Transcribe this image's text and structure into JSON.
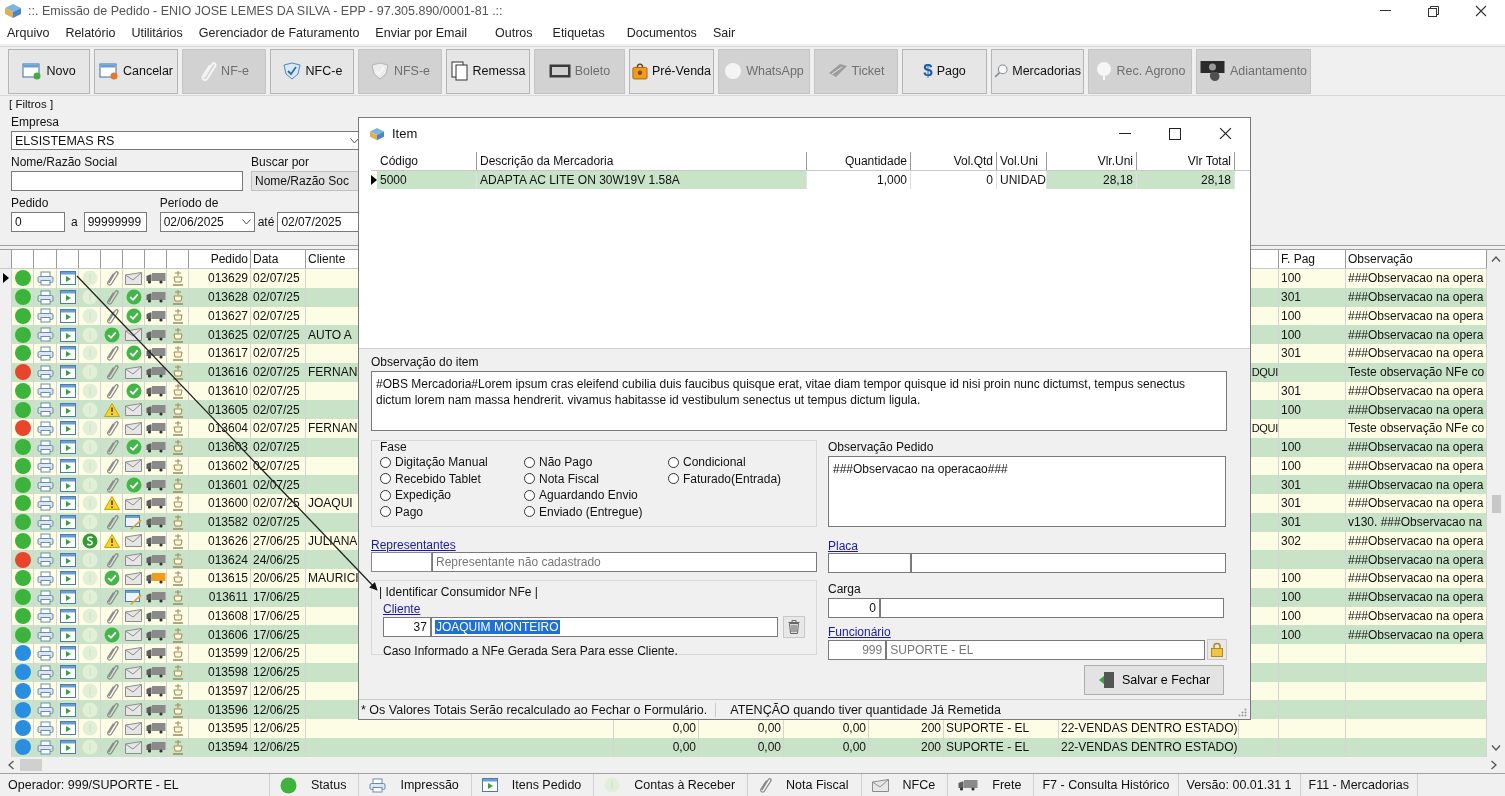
{
  "window": {
    "title": "::. Emissão de Pedido - ENIO JOSE LEMES DA SILVA - EPP - 97.305.890/0001-81 .::"
  },
  "menu": [
    "Arquivo",
    "Relatório",
    "Utilitários",
    "Gerenciador de Faturamento",
    "Enviar por Email",
    "Outros",
    "Etiquetas",
    "Documentos",
    "Sair"
  ],
  "toolbar": [
    {
      "label": "Novo",
      "disabled": false
    },
    {
      "label": "Cancelar",
      "disabled": false
    },
    {
      "label": "NF-e",
      "disabled": true
    },
    {
      "label": "NFC-e",
      "disabled": false
    },
    {
      "label": "NFS-e",
      "disabled": true
    },
    {
      "label": "Remessa",
      "disabled": false
    },
    {
      "label": "Boleto",
      "disabled": true
    },
    {
      "label": "Pré-Venda",
      "disabled": false
    },
    {
      "label": "WhatsApp",
      "disabled": true
    },
    {
      "label": "Ticket",
      "disabled": true
    },
    {
      "label": "Pago",
      "disabled": false,
      "symbol": "$"
    },
    {
      "label": "Mercadorias",
      "disabled": false
    },
    {
      "label": "Rec. Agrono",
      "disabled": true
    },
    {
      "label": "Adiantamento",
      "disabled": true
    }
  ],
  "filters": {
    "title": "[ Filtros ]",
    "empresa": {
      "label": "Empresa",
      "value": "ELSISTEMAS RS"
    },
    "nome": {
      "label": "Nome/Razão Social"
    },
    "buscar_por": {
      "label": "Buscar por",
      "value": "Nome/Razão Soc"
    },
    "pedido": {
      "label": "Pedido",
      "from": "0",
      "separator": "a",
      "to": "99999999"
    },
    "periodo": {
      "label": "Período de",
      "from": "02/06/2025",
      "separator": "até",
      "to": "02/07/2025"
    }
  },
  "grid": {
    "columns": [
      "Pedido",
      "Data",
      "Cliente",
      "F. Pag",
      "Observação"
    ],
    "rows": [
      {
        "selected": true,
        "color": "#3cb43c",
        "pago": false,
        "nota": {
          "kind": "clip"
        },
        "nfce": {
          "kind": "mail"
        },
        "frete": false,
        "pedido": "013629",
        "data": "02/07/25",
        "f_pag": "100",
        "observacao": "###Observacao na opera"
      },
      {
        "selected": false,
        "color": "#3cb43c",
        "pago": false,
        "nota": {
          "kind": "clip"
        },
        "nfce": {
          "kind": "check"
        },
        "frete": false,
        "pedido": "013628",
        "data": "02/07/25",
        "f_pag": "301",
        "observacao": "###Observacao na opera"
      },
      {
        "selected": false,
        "color": "#3cb43c",
        "pago": false,
        "nota": {
          "kind": "clip"
        },
        "nfce": {
          "kind": "check"
        },
        "frete": false,
        "pedido": "013627",
        "data": "02/07/25",
        "f_pag": "100",
        "observacao": "###Observacao na opera"
      },
      {
        "selected": false,
        "color": "#3cb43c",
        "pago": false,
        "nota": {
          "kind": "check"
        },
        "nfce": {
          "kind": "mail"
        },
        "frete": false,
        "pedido": "013625",
        "data": "02/07/25",
        "cliente": "AUTO A",
        "f_pag": "100",
        "observacao": "###Observacao na opera"
      },
      {
        "selected": false,
        "color": "#3cb43c",
        "pago": false,
        "nota": {
          "kind": "clip"
        },
        "nfce": {
          "kind": "check"
        },
        "frete": false,
        "pedido": "013617",
        "data": "02/07/25",
        "f_pag": "301",
        "observacao": "###Observacao na opera"
      },
      {
        "selected": false,
        "color": "#e8452c",
        "pago": false,
        "nota": {
          "kind": "clip"
        },
        "nfce": {
          "kind": "mail"
        },
        "frete": false,
        "pedido": "013616",
        "data": "02/07/25",
        "cliente": "FERNAN",
        "column_15": "DQUI",
        "observacao": "Teste observação NFe co"
      },
      {
        "selected": false,
        "color": "#3cb43c",
        "pago": false,
        "nota": {
          "kind": "clip"
        },
        "nfce": {
          "kind": "check"
        },
        "frete": false,
        "pedido": "013610",
        "data": "02/07/25",
        "f_pag": "301",
        "observacao": "###Observacao na opera"
      },
      {
        "selected": false,
        "color": "#3cb43c",
        "pago": false,
        "nota": {
          "kind": "warning"
        },
        "nfce": {
          "kind": "mail"
        },
        "frete": false,
        "pedido": "013605",
        "data": "02/07/25",
        "f_pag": "100",
        "observacao": "###Observacao na opera"
      },
      {
        "selected": false,
        "color": "#e8452c",
        "pago": false,
        "nota": {
          "kind": "clip"
        },
        "nfce": {
          "kind": "mail"
        },
        "frete": false,
        "pedido": "013604",
        "data": "02/07/25",
        "cliente": "FERNAN",
        "column_15": "DQUI",
        "observacao": "Teste observação NFe co"
      },
      {
        "selected": false,
        "color": "#3cb43c",
        "pago": false,
        "nota": {
          "kind": "clip"
        },
        "nfce": {
          "kind": "check"
        },
        "frete": false,
        "pedido": "013603",
        "data": "02/07/25",
        "f_pag": "100",
        "observacao": "###Observacao na opera"
      },
      {
        "selected": false,
        "color": "#3cb43c",
        "pago": false,
        "nota": {
          "kind": "clip"
        },
        "nfce": {
          "kind": "mail"
        },
        "frete": false,
        "pedido": "013602",
        "data": "02/07/25",
        "f_pag": "100",
        "observacao": "###Observacao na opera"
      },
      {
        "selected": false,
        "color": "#3cb43c",
        "pago": false,
        "nota": {
          "kind": "clip"
        },
        "nfce": {
          "kind": "check"
        },
        "frete": false,
        "pedido": "013601",
        "data": "02/07/25",
        "f_pag": "301",
        "observacao": "###Observacao na opera"
      },
      {
        "selected": false,
        "color": "#3cb43c",
        "pago": false,
        "nota": {
          "kind": "warning"
        },
        "nfce": {
          "kind": "mail"
        },
        "frete": false,
        "pedido": "013600",
        "data": "02/07/25",
        "cliente": "JOAQUI",
        "f_pag": "301",
        "observacao": "###Observacao na opera"
      },
      {
        "selected": false,
        "color": "#3cb43c",
        "pago": false,
        "nota": {
          "kind": "clip"
        },
        "nfce": {
          "kind": "edit"
        },
        "frete": false,
        "pedido": "013582",
        "data": "02/07/25",
        "f_pag": "301",
        "observacao": "v130. ###Observacao na"
      },
      {
        "selected": false,
        "color": "#3cb43c",
        "pago": true,
        "nota": {
          "kind": "warning"
        },
        "nfce": {
          "kind": "mail"
        },
        "frete": false,
        "pedido": "013626",
        "data": "27/06/25",
        "cliente": "JULIANA",
        "f_pag": "302",
        "observacao": "###Observacao na opera"
      },
      {
        "selected": false,
        "color": "#e8452c",
        "pago": false,
        "nota": {
          "kind": "clip"
        },
        "nfce": {
          "kind": "mail"
        },
        "frete": false,
        "pedido": "013624",
        "data": "24/06/25",
        "observacao": "###Observacao na opera"
      },
      {
        "selected": false,
        "color": "#3cb43c",
        "pago": false,
        "nota": {
          "kind": "check"
        },
        "nfce": {
          "kind": "mail"
        },
        "frete": true,
        "pedido": "013615",
        "data": "20/06/25",
        "cliente": "MAURICI",
        "f_pag": "100",
        "observacao": "###Observacao na opera"
      },
      {
        "selected": false,
        "color": "#3cb43c",
        "pago": false,
        "nota": {
          "kind": "clip"
        },
        "nfce": {
          "kind": "edit"
        },
        "frete": false,
        "pedido": "013611",
        "data": "17/06/25",
        "f_pag": "100",
        "observacao": "###Observacao na opera"
      },
      {
        "selected": false,
        "color": "#3cb43c",
        "pago": false,
        "nota": {
          "kind": "clip"
        },
        "nfce": {
          "kind": "mail"
        },
        "frete": false,
        "pedido": "013608",
        "data": "17/06/25",
        "f_pag": "100",
        "observacao": "###Observacao na opera"
      },
      {
        "selected": false,
        "color": "#3cb43c",
        "pago": false,
        "nota": {
          "kind": "check"
        },
        "nfce": {
          "kind": "mail"
        },
        "frete": false,
        "pedido": "013606",
        "data": "17/06/25",
        "f_pag": "100",
        "observacao": "###Observacao na opera"
      },
      {
        "selected": false,
        "color": "#2a8ee0",
        "pago": false,
        "nota": {
          "kind": "clip"
        },
        "nfce": {
          "kind": "mail"
        },
        "frete": false,
        "pedido": "013599",
        "data": "12/06/25"
      },
      {
        "selected": false,
        "color": "#2a8ee0",
        "pago": false,
        "nota": {
          "kind": "clip"
        },
        "nfce": {
          "kind": "mail"
        },
        "frete": false,
        "pedido": "013598",
        "data": "12/06/25"
      },
      {
        "selected": false,
        "color": "#2a8ee0",
        "pago": false,
        "nota": {
          "kind": "clip"
        },
        "nfce": {
          "kind": "mail"
        },
        "frete": false,
        "pedido": "013597",
        "data": "12/06/25"
      },
      {
        "selected": false,
        "color": "#2a8ee0",
        "pago": false,
        "nota": {
          "kind": "clip"
        },
        "nfce": {
          "kind": "mail"
        },
        "frete": false,
        "pedido": "013596",
        "data": "12/06/25"
      },
      {
        "selected": false,
        "color": "#2a8ee0",
        "pago": false,
        "nota": {
          "kind": "clip"
        },
        "nfce": {
          "kind": "mail"
        },
        "frete": false,
        "pedido": "013595",
        "data": "12/06/25",
        "column_9": "0,00",
        "column_10": "0,00",
        "column_11": "0,00",
        "column_12": "200",
        "column_13": "SUPORTE - EL",
        "column_14": "22-VENDAS DENTRO ESTADO)"
      },
      {
        "selected": false,
        "color": "#2a8ee0",
        "pago": false,
        "nota": {
          "kind": "clip"
        },
        "nfce": {
          "kind": "mail"
        },
        "frete": false,
        "pedido": "013594",
        "data": "12/06/25",
        "column_9": "0,00",
        "column_10": "0,00",
        "column_11": "0,00",
        "column_12": "200",
        "column_13": "SUPORTE - EL",
        "column_14": "22-VENDAS DENTRO ESTADO)"
      }
    ]
  },
  "dialog": {
    "title": "Item",
    "items": {
      "columns": [
        "Código",
        "Descrição da Mercadoria",
        "Quantidade",
        "Vol.Qtd",
        "Vol.Uni",
        "Vlr.Uni",
        "Vlr Total"
      ],
      "rows": [
        {
          "selected": true,
          "cells": [
            "5000",
            "ADAPTA AC LITE ON 30W19V 1.58A",
            "1,000",
            "0",
            "UNIDAD",
            "28,18",
            "28,18"
          ]
        }
      ]
    },
    "observacao_item": {
      "label": "Observação do item",
      "value": "#OBS Mercadoria#Lorem ipsum cras eleifend cubilia duis faucibus quisque erat, vitae diam tempor quisque id nisi proin nunc dictumst, tempus senectus dictum lorem nam massa hendrerit. vivamus habitasse id vestibulum senectus ut tempus dictum ligula."
    },
    "fase": {
      "title": "Fase",
      "options": [
        {
          "label": "Digitação Manual",
          "selected": false
        },
        {
          "label": "Recebido Tablet",
          "selected": false
        },
        {
          "label": "Expedição",
          "selected": false
        },
        {
          "label": "Pago",
          "selected": false
        },
        {
          "label": "Não Pago",
          "selected": false
        },
        {
          "label": "Nota Fiscal",
          "selected": false
        },
        {
          "label": "Aguardando Envio",
          "selected": false
        },
        {
          "label": "Enviado (Entregue)",
          "selected": false
        },
        {
          "label": "Condicional",
          "selected": false
        },
        {
          "label": "Faturado(Entrada)",
          "selected": false
        }
      ]
    },
    "observacao_pedido": {
      "label": "Observação Pedido",
      "value": "###Observacao na operacao###"
    },
    "representantes": {
      "label": "Representantes",
      "name": "Representante não cadastrado"
    },
    "placa": {
      "label": "Placa"
    },
    "consumidor": {
      "title": "| Identificar Consumidor NFe |",
      "label": "Cliente",
      "code": "37",
      "name": "JOAQUIM MONTEIRO",
      "note": "Caso Informado a NFe Gerada Sera Para esse Cliente."
    },
    "carga": {
      "label": "Carga",
      "value": "0"
    },
    "funcionario": {
      "label": "Funcionário",
      "code": "999",
      "name": "SUPORTE - EL"
    },
    "save_button": "Salvar e Fechar",
    "status": [
      "* Os Valores Totais Serão recalculado ao Fechar o Formulário.",
      "ATENÇÃO quando tiver quantidade Já Remetida"
    ]
  },
  "status_bar": {
    "operator": "Operador: 999/SUPORTE - EL",
    "legend": [
      {
        "kind": "status",
        "label": "Status"
      },
      {
        "kind": "print",
        "label": "Impressão"
      },
      {
        "kind": "items",
        "label": "Itens Pedido"
      },
      {
        "kind": "receivable",
        "label": "Contas à Receber"
      },
      {
        "kind": "invoice",
        "label": "Nota Fiscal"
      },
      {
        "kind": "nfce",
        "label": "NFCe"
      },
      {
        "kind": "freight",
        "label": "Frete"
      }
    ],
    "shortcuts": [
      "F7 - Consulta Histórico",
      "Versão: 00.01.31 1",
      "F11 - Mercadorias"
    ]
  }
}
